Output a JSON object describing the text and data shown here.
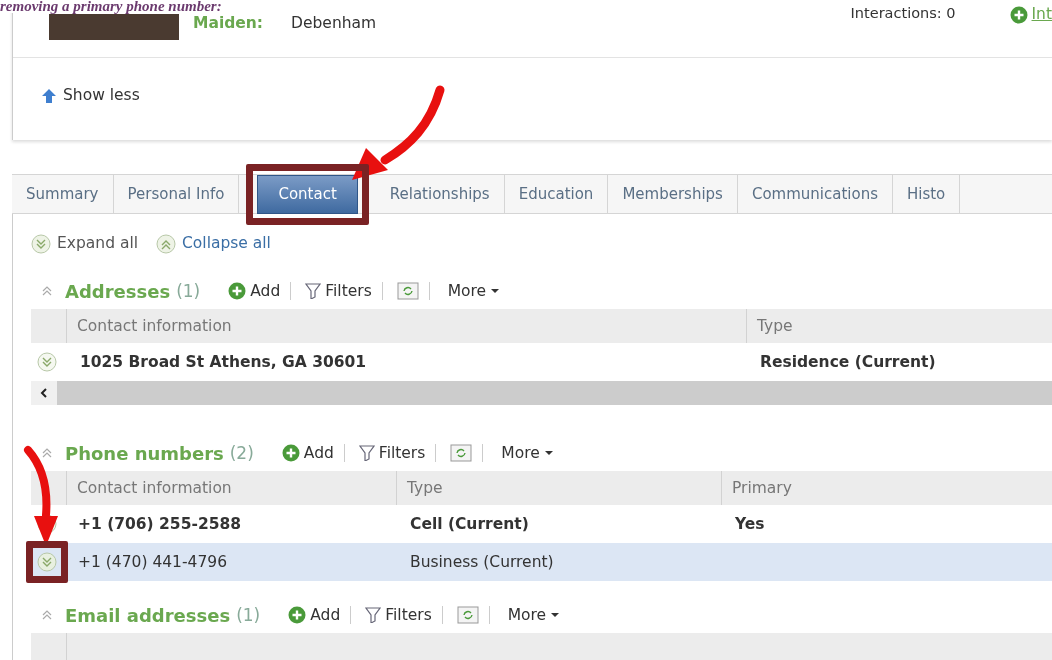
{
  "caption": "removing a primary phone number:",
  "profile": {
    "maiden_label": "Maiden:",
    "maiden_value": "Debenham",
    "interactions": "Interactions: 0",
    "link": "Int"
  },
  "show_less": "Show less",
  "tabs": [
    {
      "label": "Summary",
      "selected": false
    },
    {
      "label": "Personal Info",
      "selected": false
    },
    {
      "label": "Contact",
      "selected": true
    },
    {
      "label": "Relationships",
      "selected": false
    },
    {
      "label": "Education",
      "selected": false
    },
    {
      "label": "Memberships",
      "selected": false
    },
    {
      "label": "Communications",
      "selected": false
    },
    {
      "label": "Histo",
      "selected": false
    }
  ],
  "expand_all": "Expand all",
  "collapse_all": "Collapse all",
  "sections": [
    {
      "title": "Addresses",
      "count": "(1)",
      "add": "Add",
      "filters": "Filters",
      "more": "More",
      "columns": [
        "Contact information",
        "Type"
      ],
      "scrollbar": true,
      "rows": [
        {
          "cells": [
            "1025 Broad St Athens, GA 30601",
            "Residence (Current)"
          ],
          "bold": true,
          "selected": false
        }
      ]
    },
    {
      "title": "Phone numbers",
      "count": "(2)",
      "add": "Add",
      "filters": "Filters",
      "more": "More",
      "columns": [
        "Contact information",
        "Type",
        "Primary"
      ],
      "rows": [
        {
          "cells": [
            "+1 (706) 255-2588",
            "Cell (Current)",
            "Yes"
          ],
          "bold": true,
          "selected": false
        },
        {
          "cells": [
            "+1 (470) 441-4796",
            "Business (Current)",
            ""
          ],
          "bold": false,
          "selected": true
        }
      ]
    },
    {
      "title": "Email addresses",
      "count": "(1)",
      "add": "Add",
      "filters": "Filters",
      "more": "More"
    }
  ]
}
